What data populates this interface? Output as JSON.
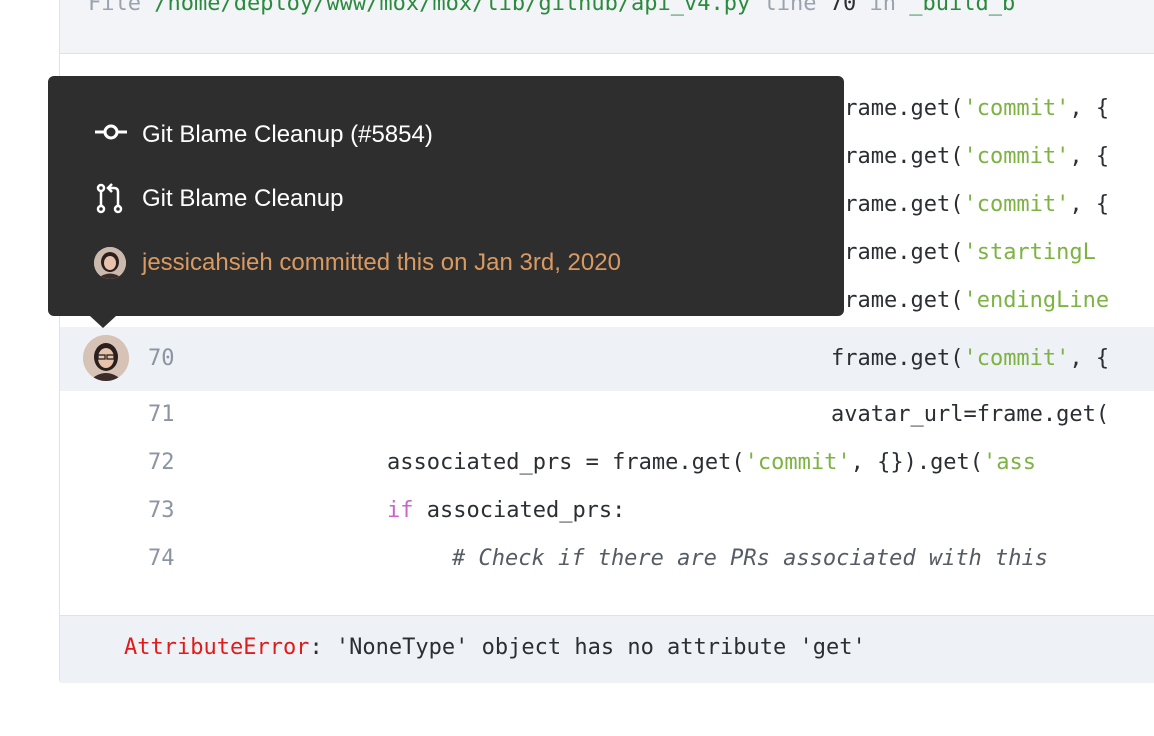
{
  "file_bar": {
    "prefix": "File",
    "path": "/home/deploy/www/mox/mox/lib/github/api_v4.py",
    "line_word": "line",
    "line_number": "70",
    "in_word": "in",
    "function": "_build_b"
  },
  "code_lines": [
    {
      "content": "frame.get('commit', {"
    },
    {
      "content": "frame.get('commit', {"
    },
    {
      "content": "frame.get('commit', {"
    },
    {
      "content": "frame.get('startingL"
    },
    {
      "content": "frame.get('endingLine"
    },
    {
      "number": "70",
      "pre": "frame.get(",
      "str": "'commit'",
      "post": ", {"
    },
    {
      "number": "71",
      "pre": "avatar_url=frame.get("
    },
    {
      "number": "72",
      "pre": "associated_prs = frame.get(",
      "str": "'commit'",
      "mid": ", {}).get(",
      "str2": "'ass"
    },
    {
      "number": "73",
      "kw": "if",
      "post": " associated_prs:"
    },
    {
      "number": "74",
      "comment": "# Check if there are PRs associated with this"
    }
  ],
  "error": {
    "type": "AttributeError",
    "message": ": 'NoneType' object has no attribute 'get'"
  },
  "tooltip": {
    "commit_title": "Git Blame Cleanup (#5854)",
    "pr_title": "Git Blame Cleanup",
    "author_line": "jessicahsieh committed this on Jan 3rd, 2020"
  },
  "colors": {
    "string": "#7cb342",
    "keyword": "#c964c8",
    "error_type": "#e01b1b",
    "tooltip_bg": "#2e2e2e",
    "author": "#d99a62",
    "highlight_row": "#eef1f5"
  },
  "icons": [
    "commit-icon",
    "pull-request-icon",
    "avatar"
  ]
}
